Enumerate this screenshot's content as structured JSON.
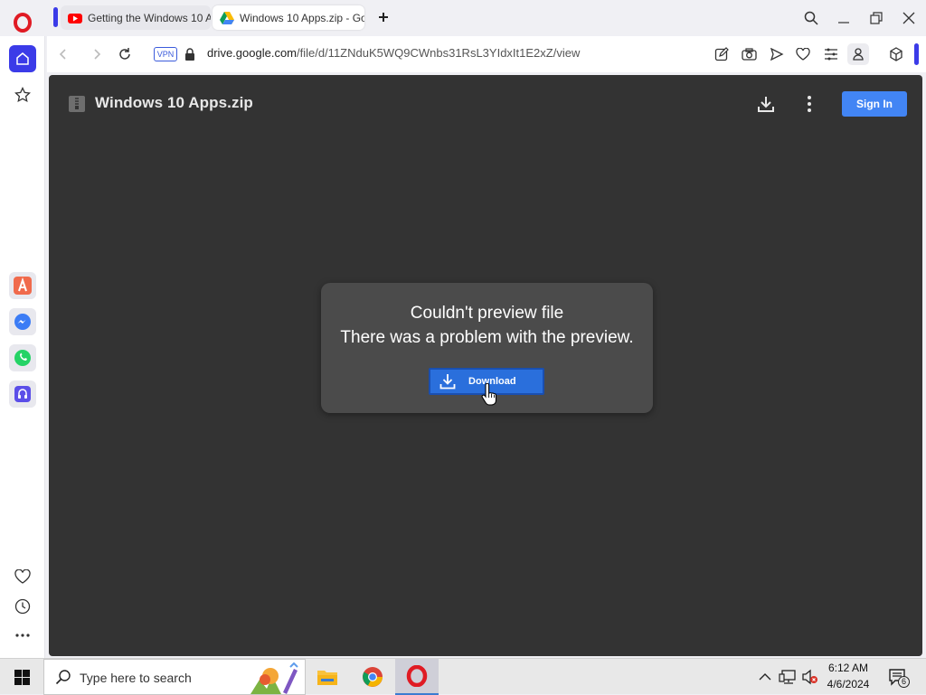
{
  "browser": {
    "tabs": [
      {
        "title": "Getting the Windows 10 A",
        "active": false,
        "favicon": "youtube-icon"
      },
      {
        "title": "Windows 10 Apps.zip - Go",
        "active": true,
        "favicon": "google-drive-icon"
      }
    ],
    "new_tab_icon": "plus-icon",
    "address_bar": {
      "vpn_label": "VPN",
      "url_domain": "drive.google.com",
      "url_path": "/file/d/11ZNduK5WQ9CWnbs31RsL3YIdxIt1E2xZ/view"
    },
    "toolbar_icons": [
      "back-icon",
      "forward-icon",
      "reload-icon",
      "lock-icon",
      "edit-icon",
      "camera-icon",
      "send-icon",
      "heart-icon",
      "menu-icon",
      "profile-icon",
      "extensions-icon"
    ],
    "sidebar_icons": [
      "opera-logo",
      "home-icon",
      "star-icon",
      "aria-icon",
      "messenger-icon",
      "whatsapp-icon",
      "music-icon",
      "heart-icon",
      "history-icon",
      "more-icon"
    ]
  },
  "viewer": {
    "file_name": "Windows 10 Apps.zip",
    "sign_in_label": "Sign In",
    "preview_error": {
      "title": "Couldn't preview file",
      "message": "There was a problem with the preview.",
      "download_label": "Download"
    }
  },
  "taskbar": {
    "search_placeholder": "Type here to search",
    "time": "6:12 AM",
    "date": "4/6/2024",
    "notification_count": "6",
    "pinned_apps": [
      "file-explorer-icon",
      "chrome-icon",
      "opera-icon"
    ]
  },
  "colors": {
    "viewer_bg": "#333333",
    "card_bg": "#4b4b4b",
    "sign_in": "#4285f4",
    "download_btn": "#2a6fdc",
    "opera_red": "#e01b24",
    "accent": "#3b3be8"
  }
}
